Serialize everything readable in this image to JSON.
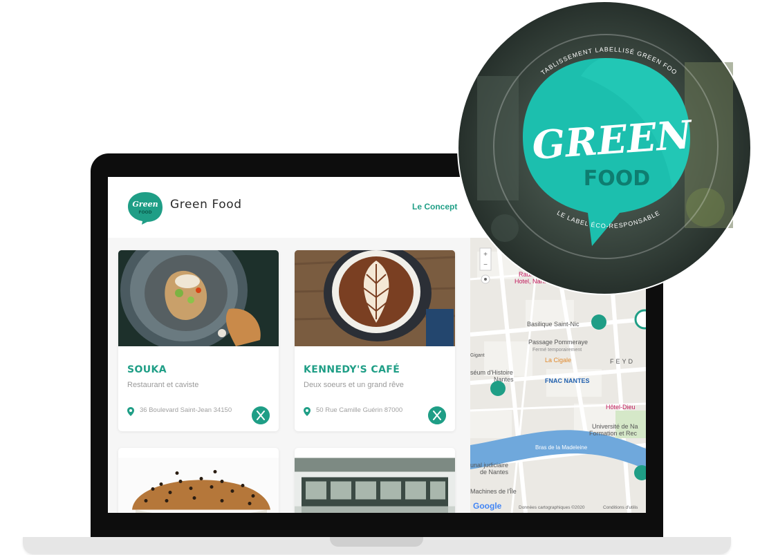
{
  "header": {
    "brand": "Green Food",
    "nav_concept": "Le Concept"
  },
  "cards": [
    {
      "name": "SOUKA",
      "description": "Restaurant et caviste",
      "address": "36 Boulevard Saint-Jean 34150"
    },
    {
      "name": "KENNEDY'S CAFÉ",
      "description": "Deux soeurs et un grand rêve",
      "address": "50 Rue Camille Guérin 87000"
    }
  ],
  "map": {
    "labels": [
      "Radisson Blu",
      "Hotel, Nantes",
      "Basilique Saint-Nic",
      "Passage Pommeraye",
      "Fermé temporairement",
      "La Cigale",
      "FNAC NANTES",
      "séum d'Histoire",
      "Nantes",
      "Hôtel-Dieu",
      "Université de Na",
      "Formation et Rec",
      "Bras de la Madeleine",
      "unal judiciaire",
      "de Nantes",
      "Machines de l'Île",
      "FEYD",
      "Gigant",
      "Google",
      "Données cartographiques ©2020",
      "Conditions d'utilis"
    ],
    "zoom_in": "+",
    "zoom_out": "−"
  },
  "sticker": {
    "top_text": "ÉTABLISSEMENT LABELLISÉ GREEN FOOD",
    "logo_top": "GREEN",
    "logo_bottom": "FOOD",
    "bottom_text": "LE LABEL ÉCO-RESPONSABLE"
  },
  "colors": {
    "brand_green": "#1f9e86",
    "sticker_teal": "#1cbfae"
  }
}
